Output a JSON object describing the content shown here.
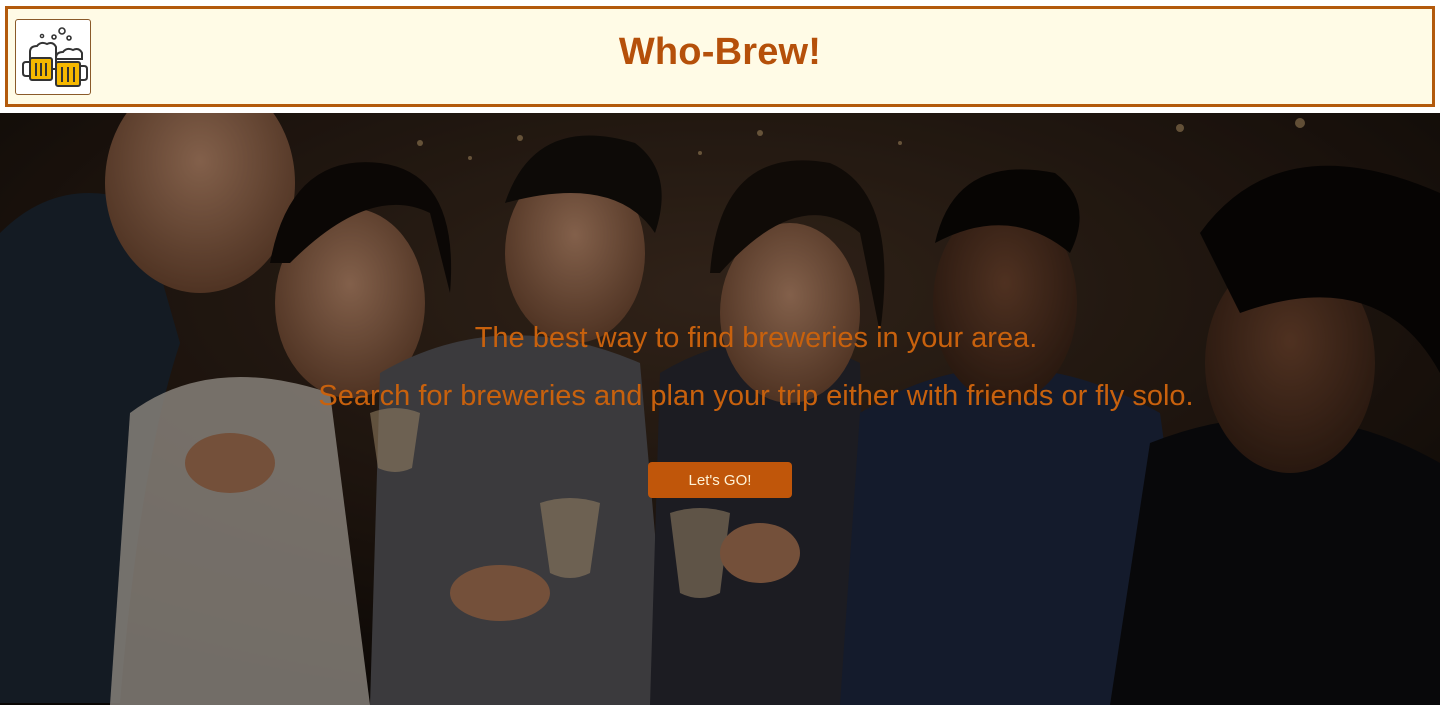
{
  "header": {
    "title": "Who-Brew!",
    "logo_icon": "beer-mugs-icon"
  },
  "hero": {
    "tagline_1": "The best way to find breweries in your area.",
    "tagline_2": "Search for breweries and plan your trip either with friends or fly solo.",
    "cta_label": "Let's GO!"
  },
  "colors": {
    "brand": "#b5500a",
    "header_bg": "#fffbe6",
    "header_border": "#b35a0c",
    "button_bg": "#c0560a",
    "tagline": "#c8610d"
  }
}
